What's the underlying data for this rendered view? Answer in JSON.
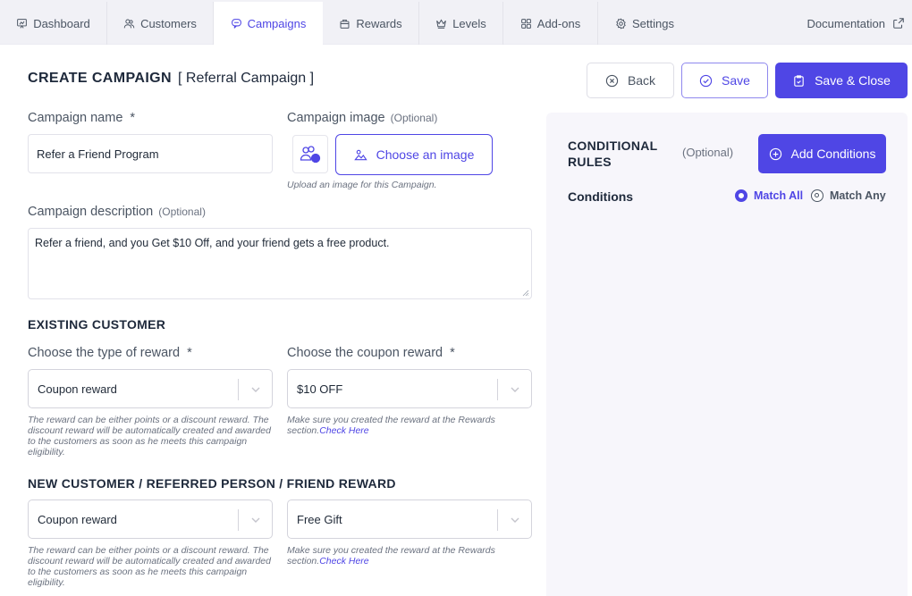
{
  "nav": {
    "tabs": [
      {
        "label": "Dashboard",
        "icon": "presentation-chart-icon",
        "active": false
      },
      {
        "label": "Customers",
        "icon": "users-icon",
        "active": false
      },
      {
        "label": "Campaigns",
        "icon": "chat-bubble-icon",
        "active": true
      },
      {
        "label": "Rewards",
        "icon": "gift-icon",
        "active": false
      },
      {
        "label": "Levels",
        "icon": "crown-icon",
        "active": false
      },
      {
        "label": "Add-ons",
        "icon": "grid-icon",
        "active": false
      },
      {
        "label": "Settings",
        "icon": "gear-icon",
        "active": false
      }
    ],
    "documentation": "Documentation"
  },
  "header": {
    "title": "CREATE CAMPAIGN",
    "subtitle": "[ Referral Campaign ]",
    "back_label": "Back",
    "save_label": "Save",
    "save_close_label": "Save & Close"
  },
  "form": {
    "name": {
      "label": "Campaign name",
      "required_mark": "*",
      "value": "Refer a Friend Program"
    },
    "image": {
      "label": "Campaign image",
      "optional": "(Optional)",
      "choose_label": "Choose an image",
      "hint": "Upload an image for this Campaign."
    },
    "description": {
      "label": "Campaign description",
      "optional": "(Optional)",
      "value": "Refer a friend, and you Get $10 Off, and your friend gets a free product."
    },
    "existing": {
      "title": "EXISTING CUSTOMER",
      "type_label": "Choose the type of reward",
      "type_value": "Coupon reward",
      "type_hint": "The reward can be either points or a discount reward. The discount reward will be automatically created and awarded to the customers as soon as he meets this campaign eligibility.",
      "coupon_label": "Choose the coupon reward",
      "coupon_value": "$10 OFF",
      "coupon_hint": "Make sure you created the reward at the Rewards section.",
      "check_here": "Check Here",
      "required_mark": "*"
    },
    "friend": {
      "title": "NEW CUSTOMER / REFERRED PERSON / FRIEND REWARD",
      "type_value": "Coupon reward",
      "type_hint": "The reward can be either points or a discount reward. The discount reward will be automatically created and awarded to the customers as soon as he meets this campaign eligibility.",
      "coupon_value": "Free Gift",
      "coupon_hint": "Make sure you created the reward at the Rewards section.",
      "check_here": "Check Here"
    }
  },
  "conditions": {
    "title_line1": "CONDITIONAL",
    "title_line2": "RULES",
    "optional": "(Optional)",
    "add_label": "Add Conditions",
    "conditions_label": "Conditions",
    "match_all": "Match All",
    "match_any": "Match Any",
    "selected": "Match All"
  },
  "colors": {
    "accent": "#4f46e5",
    "nav_bg": "#f1f1f6",
    "panel_bg": "#f7f6fb"
  }
}
